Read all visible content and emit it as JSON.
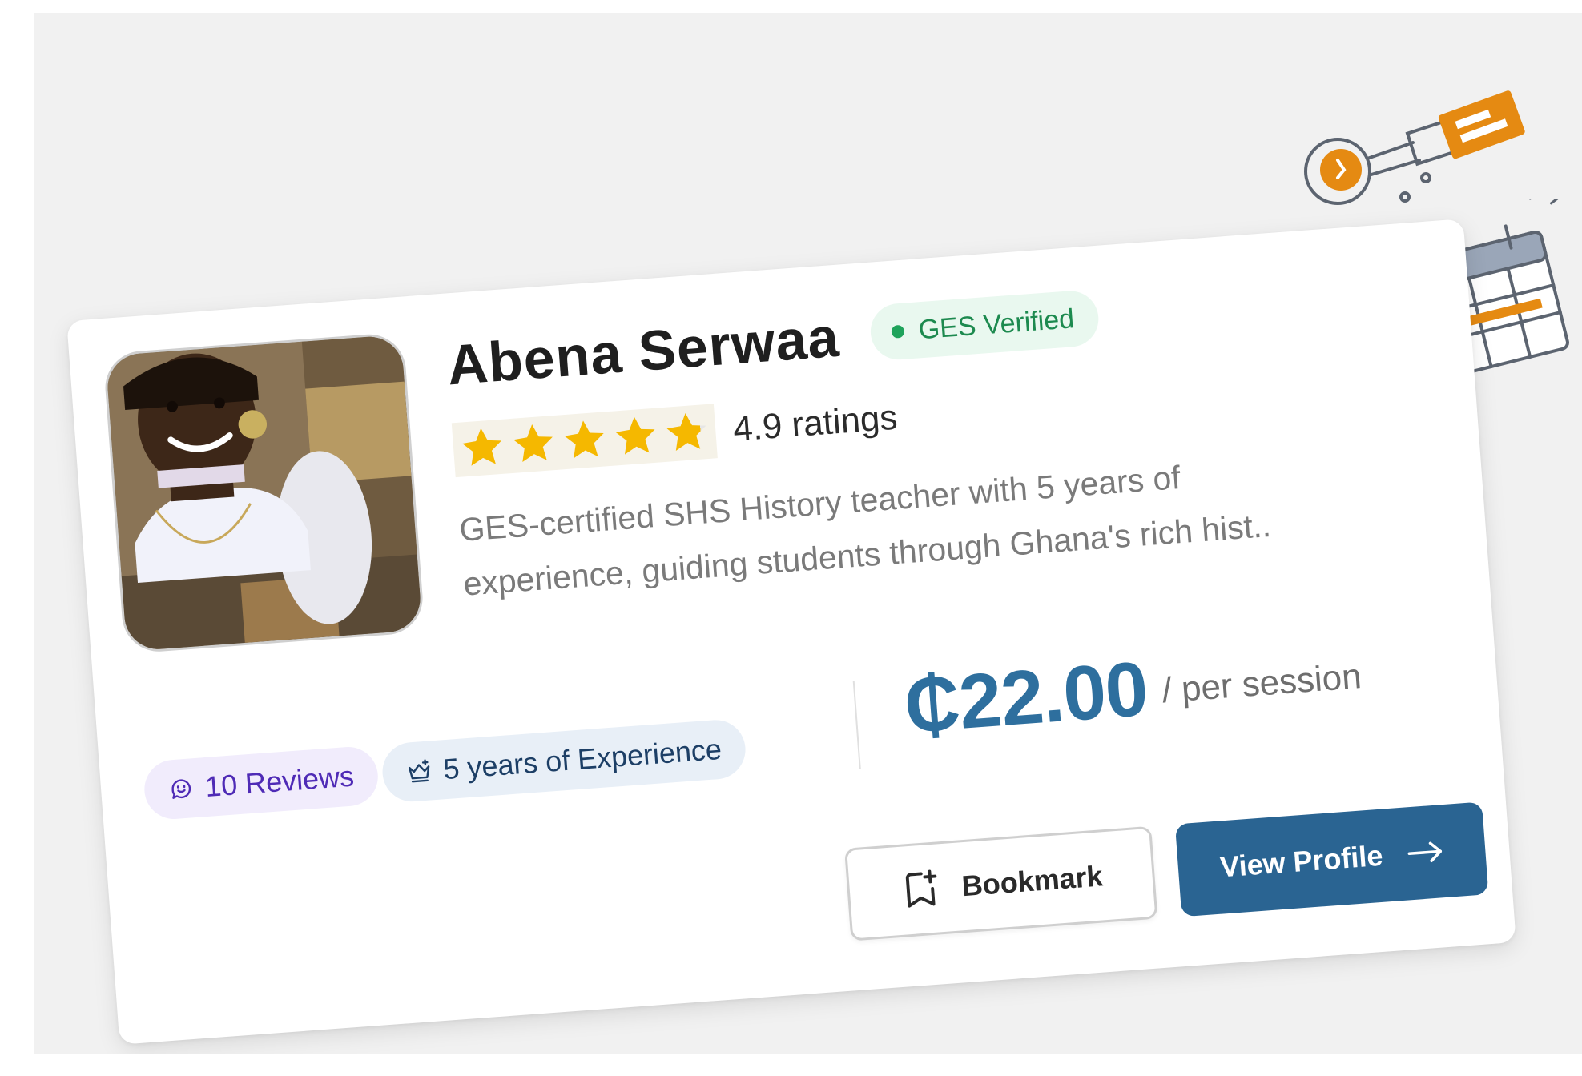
{
  "tutor": {
    "name": "Abena Serwaa",
    "verified_badge": "GES Verified",
    "rating_text": "4.9 ratings",
    "rating_value": 4.9,
    "rating_max": 5,
    "description_line1": "GES-certified SHS History teacher with 5 years of",
    "description_line2": "experience, guiding students through Ghana's rich hist.."
  },
  "stats": {
    "reviews": "10 Reviews",
    "experience": "5 years of Experience"
  },
  "pricing": {
    "price": "₵22.00",
    "unit": "/ per session"
  },
  "actions": {
    "bookmark_label": "Bookmark",
    "view_profile_label": "View Profile"
  },
  "icons": {
    "verified": "dot-icon",
    "reviews": "chat-smile-icon",
    "experience": "crown-icon",
    "bookmark": "bookmark-add-icon",
    "view_profile": "arrow-right-icon"
  },
  "colors": {
    "accent": "#2a6492",
    "price": "#2e6f9e",
    "verified_text": "#1d8a4f",
    "verified_bg": "#e9f8ef",
    "reviews_text": "#4f2bb6",
    "reviews_bg": "#f1ecfc",
    "experience_text": "#1d3f66",
    "experience_bg": "#e8eff7",
    "star": "#f5b800",
    "illustration_orange": "#e58a12"
  }
}
